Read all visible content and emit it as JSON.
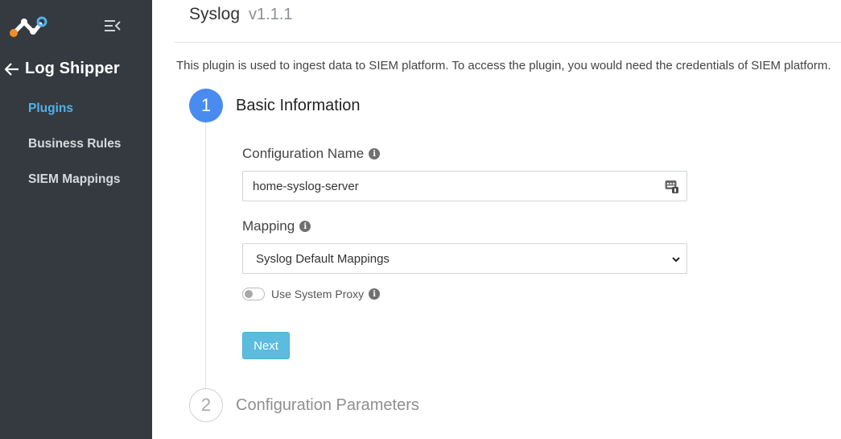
{
  "sidebar": {
    "back_title": "Log Shipper",
    "items": [
      {
        "label": "Plugins",
        "active": true
      },
      {
        "label": "Business Rules",
        "active": false
      },
      {
        "label": "SIEM Mappings",
        "active": false
      }
    ]
  },
  "header": {
    "name": "Syslog",
    "version": "v1.1.1"
  },
  "description": "This plugin is used to ingest data to SIEM platform. To access the plugin, you would need the credentials of SIEM platform.",
  "steps": [
    {
      "number": "1",
      "title": "Basic Information"
    },
    {
      "number": "2",
      "title": "Configuration Parameters"
    }
  ],
  "form": {
    "config_name_label": "Configuration Name",
    "config_name_value": "home-syslog-server",
    "mapping_label": "Mapping",
    "mapping_value": "Syslog Default Mappings",
    "proxy_label": "Use System Proxy",
    "proxy_enabled": false,
    "next_label": "Next"
  },
  "colors": {
    "sidebar_bg": "#343a40",
    "active_nav": "#4fb3e8",
    "step_active": "#4a8bf0",
    "next_button": "#5bbcde"
  },
  "icons": [
    "logo-icon",
    "menu-collapse-icon",
    "arrow-left-icon",
    "info-icon",
    "keyboard-icon",
    "chevron-down-icon"
  ]
}
